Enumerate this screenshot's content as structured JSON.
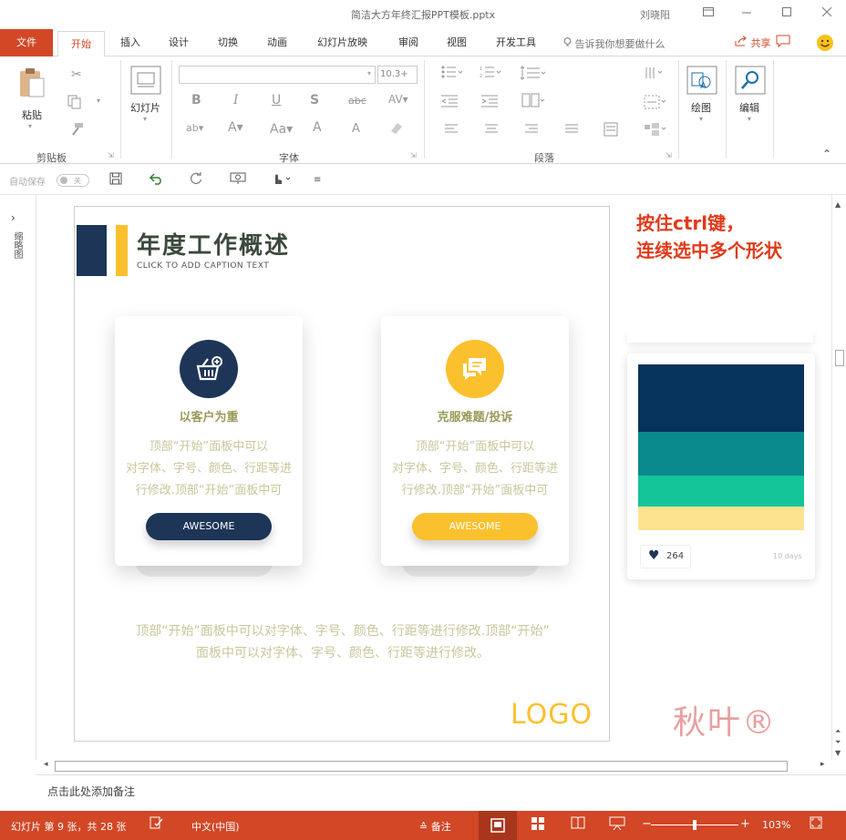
{
  "window": {
    "title": "简洁大方年终汇报PPT模板.pptx",
    "user": "刘晓阳"
  },
  "tabs": {
    "file": "文件",
    "items": [
      "开始",
      "插入",
      "设计",
      "切换",
      "动画",
      "幻灯片放映",
      "审阅",
      "视图",
      "开发工具"
    ],
    "tell_me": "告诉我你想要做什么",
    "share": "共享"
  },
  "ribbon": {
    "paste": "粘贴",
    "clipboard": "剪贴板",
    "slide": "幻灯片",
    "font_size": "10.3+",
    "font": "字体",
    "paragraph": "段落",
    "drawing": "绘图",
    "editing": "编辑"
  },
  "qat": {
    "autosave": "自动保存",
    "toggle": "关"
  },
  "rail": {
    "label": "缩略图"
  },
  "slide": {
    "title": "年度工作概述",
    "caption": "CLICK TO ADD CAPTION TEXT",
    "cards": [
      {
        "title": "以客户为重",
        "desc_lines": [
          "顶部“开始”面板中可以",
          "对字体、字号、颜色、行距等进",
          "行修改.顶部“开始”面板中可"
        ],
        "button": "AWESOME",
        "color": "#1d3557"
      },
      {
        "title": "克服难题/投诉",
        "desc_lines": [
          "顶部“开始”面板中可以",
          "对字体、字号、颜色、行距等进",
          "行修改.顶部“开始”面板中可"
        ],
        "button": "AWESOME",
        "color": "#fbc02d"
      }
    ],
    "body_lines": [
      "顶部“开始”面板中可以对字体、字号、颜色、行距等进行修改.顶部“开始”",
      "面板中可以对字体、字号、颜色、行距等进行修改。"
    ],
    "logo": "LOGO"
  },
  "annotation": {
    "line1": "按住ctrl键，",
    "line2": "连续选中多个形状"
  },
  "preview": {
    "palette": [
      "#06335a",
      "#0b8a8c",
      "#14c59a",
      "#fde290"
    ],
    "likes": "264",
    "days": "10 days"
  },
  "watermark": "秋叶®",
  "notes": {
    "placeholder": "点击此处添加备注"
  },
  "status": {
    "slide_info": "幻灯片 第 9 张，共 28 张",
    "language": "中文(中国)",
    "notes": "备注",
    "zoom": "103%"
  },
  "colors": {
    "accent": "#d24726",
    "navy": "#1d3557",
    "yellow": "#fbc02d"
  }
}
